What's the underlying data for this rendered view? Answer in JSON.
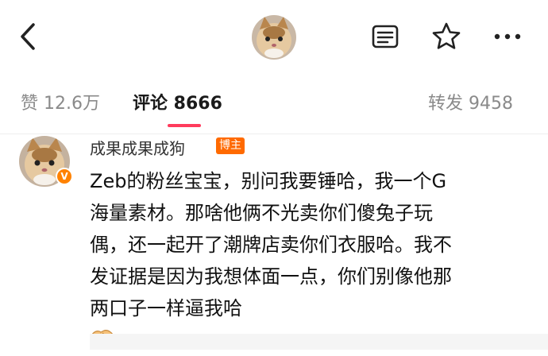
{
  "header": {
    "back_icon": "chevron-left-icon",
    "avatar": "cat-avatar",
    "actions": [
      "document-icon",
      "star-icon",
      "more-icon"
    ]
  },
  "tabs": {
    "like": "赞 12.6万",
    "comment": "评论 8666",
    "repost": "转发 9458",
    "indicator_color": "#ff3b5c"
  },
  "comment": {
    "username": "成果成果成狗",
    "badge": "博主",
    "verified": "V",
    "lines": [
      "Zeb的粉丝宝宝，别问我要锤哈，我一个G",
      "海量素材。那啥他俩不光卖你们傻兔子玩",
      "偶，还一起开了潮牌店卖你们衣服哈。我不",
      "发证据是因为我想体面一点，你们别像他那",
      "两口子一样逼我哈"
    ],
    "emoji": "handshake-emoji"
  }
}
